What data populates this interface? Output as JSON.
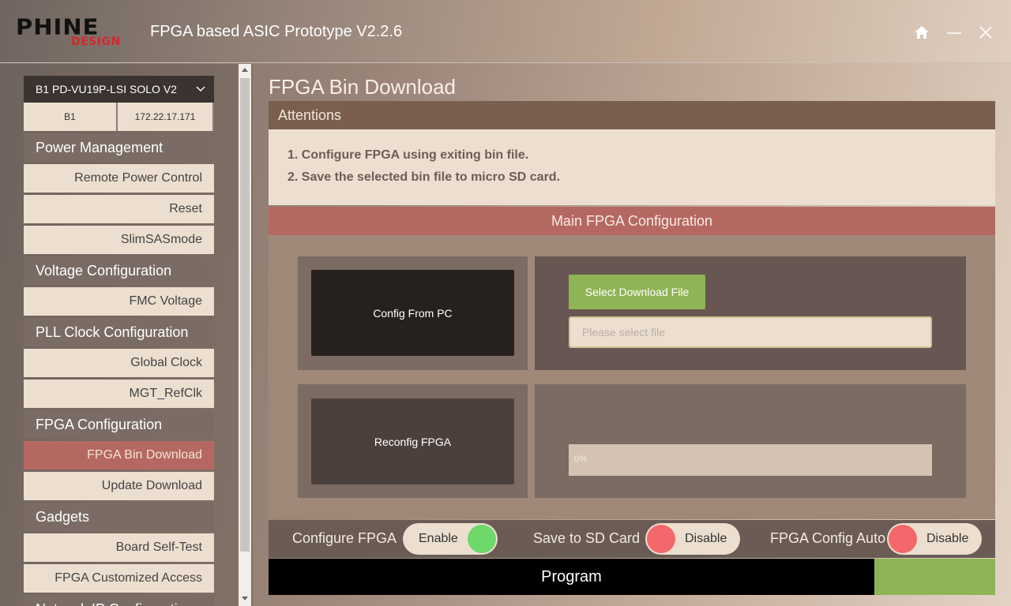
{
  "app": {
    "logo_main": "PHINE",
    "logo_sub": "DESIGN",
    "title": "FPGA based ASIC Prototype V2.2.6"
  },
  "window": {
    "home_icon": "home-icon",
    "minimize_icon": "minimize-icon",
    "close_icon": "close-icon"
  },
  "sidebar": {
    "board": {
      "selected": "B1  PD-VU19P-LSI SOLO V2",
      "id": "B1",
      "ip": "172.22.17.171"
    },
    "sections": [
      {
        "title": "Power Management",
        "items": [
          "Remote Power Control",
          "Reset",
          "SlimSASmode"
        ]
      },
      {
        "title": "Voltage Configuration",
        "items": [
          "FMC Voltage"
        ]
      },
      {
        "title": "PLL Clock Configuration",
        "items": [
          "Global Clock",
          "MGT_RefClk"
        ]
      },
      {
        "title": "FPGA Configuration",
        "items": [
          "FPGA Bin Download",
          "Update Download"
        ]
      },
      {
        "title": "Gadgets",
        "items": [
          "Board Self-Test",
          "FPGA Customized Access"
        ]
      },
      {
        "title": "Network IP Configuration",
        "items": []
      }
    ],
    "active_item": "FPGA Bin Download"
  },
  "main": {
    "page_title": "FPGA Bin Download",
    "attentions": {
      "title": "Attentions",
      "lines": [
        "1. Configure FPGA using exiting bin file.",
        "2. Save the selected bin file to micro SD card."
      ]
    },
    "config": {
      "title": "Main FPGA Configuration",
      "config_from_pc": "Config From PC",
      "reconfig": "Reconfig FPGA",
      "select_file": "Select Download File",
      "file_placeholder": "Please select file",
      "file_value": "",
      "progress_label": "0%",
      "progress_fraction": 0
    },
    "toggles": [
      {
        "label": "Configure FPGA",
        "state": "Enable",
        "color": "#6fd86a"
      },
      {
        "label": "Save to SD Card",
        "state": "Disable",
        "color": "#f4676a"
      },
      {
        "label": "FPGA Config Auto",
        "state": "Disable",
        "color": "#f4676a"
      }
    ],
    "program_label": "Program"
  },
  "colors": {
    "accent_red": "#b56861",
    "accent_green": "#8fb455",
    "header_brown": "#7b5f4e"
  }
}
